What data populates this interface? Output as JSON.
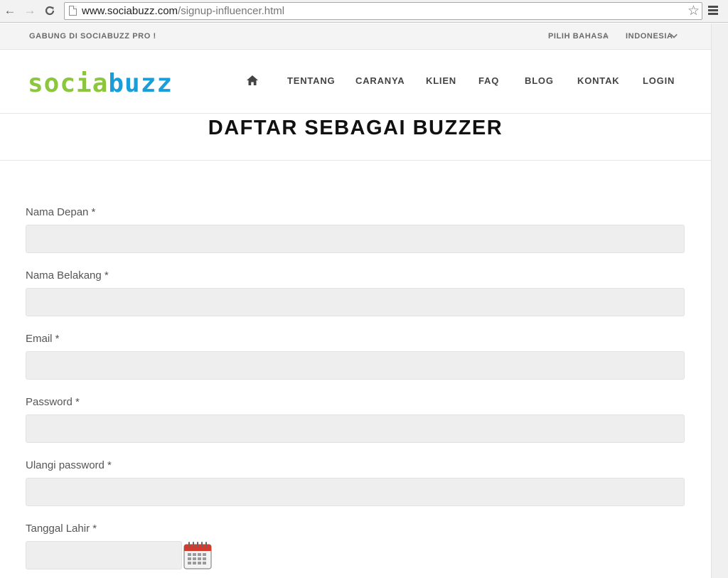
{
  "browser": {
    "url_domain": "www.sociabuzz.com",
    "url_path": "/signup-influencer.html",
    "back_icon": "←",
    "forward_icon": "→",
    "reload_icon": "C",
    "star_icon": "☆"
  },
  "topbar": {
    "promo": "GABUNG DI SOCIABUZZ PRO !",
    "language_label": "PILIH BAHASA",
    "language_separator": ">",
    "language_value": "INDONESIA"
  },
  "logo": {
    "part1": "socia",
    "part2": "buzz"
  },
  "colors": {
    "logo_green": "#8cc63f",
    "logo_blue": "#1a9ed9",
    "input_bg": "#eeeeee"
  },
  "nav": {
    "home_icon": "home-icon",
    "items": [
      "TENTANG",
      "CARANYA",
      "KLIEN",
      "FAQ",
      "BLOG",
      "KONTAK",
      "LOGIN"
    ]
  },
  "page": {
    "title": "DAFTAR SEBAGAI BUZZER"
  },
  "form": {
    "fields": [
      {
        "label": "Nama Depan *",
        "value": ""
      },
      {
        "label": "Nama Belakang *",
        "value": ""
      },
      {
        "label": "Email *",
        "value": ""
      },
      {
        "label": "Password *",
        "value": ""
      },
      {
        "label": "Ulangi password *",
        "value": ""
      },
      {
        "label": "Tanggal Lahir *",
        "value": ""
      }
    ]
  }
}
